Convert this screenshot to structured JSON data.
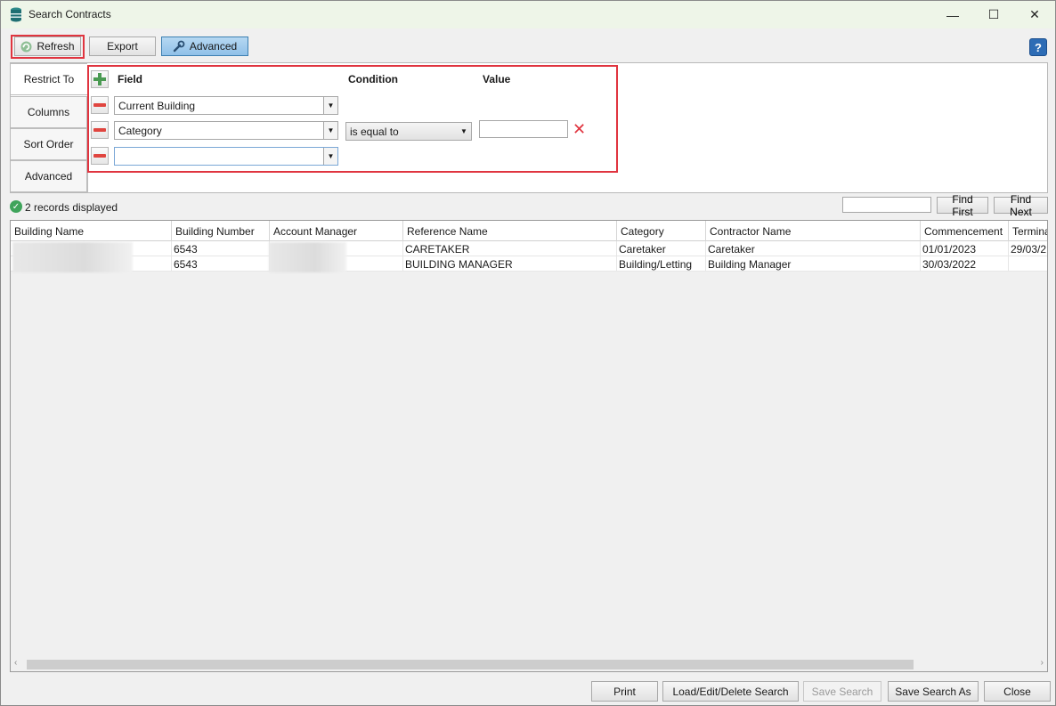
{
  "window": {
    "title": "Search Contracts",
    "minimize": "—",
    "maximize": "☐",
    "close": "✕"
  },
  "toolbar": {
    "refresh_label": "Refresh",
    "export_label": "Export",
    "advanced_label": "Advanced",
    "help_label": "?"
  },
  "tabs": [
    "Restrict To",
    "Columns",
    "Sort Order",
    "Advanced"
  ],
  "filter": {
    "headers": {
      "field": "Field",
      "condition": "Condition",
      "value": "Value"
    },
    "rules": [
      {
        "field": "Current Building",
        "condition": "",
        "value": ""
      },
      {
        "field": "Category",
        "condition": "is equal to",
        "value": ""
      },
      {
        "field": "",
        "condition": "",
        "value": ""
      }
    ]
  },
  "status": {
    "text": "2 records displayed",
    "find_first": "Find First",
    "find_next": "Find Next",
    "find_value": ""
  },
  "grid": {
    "columns": [
      "Building Name",
      "Building Number",
      "Account Manager",
      "Reference Name",
      "Category",
      "Contractor Name",
      "Commencement",
      "Termina"
    ],
    "rows": [
      [
        "",
        "6543",
        "",
        "CARETAKER",
        "Caretaker",
        "Caretaker",
        "01/01/2023",
        "29/03/2"
      ],
      [
        "",
        "6543",
        "",
        "BUILDING MANAGER",
        "Building/Letting",
        "Building Manager",
        "30/03/2022",
        ""
      ]
    ]
  },
  "footer": {
    "print": "Print",
    "load_edit_delete": "Load/Edit/Delete Search",
    "save_search": "Save Search",
    "save_search_as": "Save Search As",
    "close": "Close"
  },
  "colors": {
    "highlight": "#e0343f",
    "advanced_active": "#8fc0e8",
    "help_blue": "#2d6cb5",
    "status_green": "#3fa45b"
  },
  "icons": {
    "app": "database-icon",
    "refresh": "refresh-icon",
    "advanced": "wrench-icon",
    "help": "help-icon",
    "add": "plus-icon",
    "remove": "minus-icon",
    "clear": "close-x-icon",
    "status": "check-circle-icon"
  }
}
